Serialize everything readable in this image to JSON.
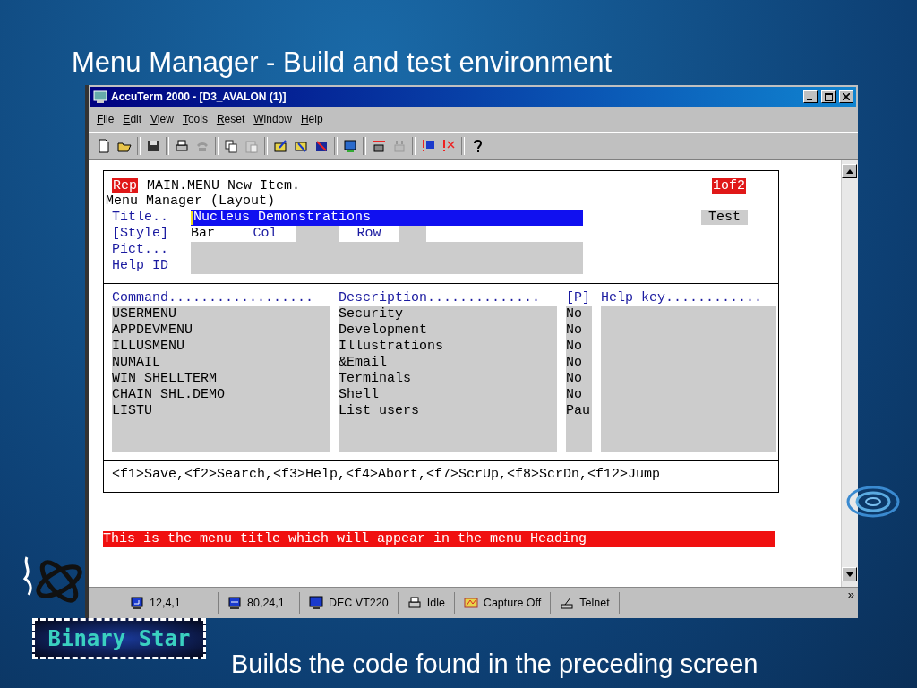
{
  "slide_title": "Menu Manager - Build and test environment",
  "window": {
    "title": "AccuTerm 2000 - [D3_AVALON (1)]"
  },
  "menu": [
    "File",
    "Edit",
    "View",
    "Tools",
    "Reset",
    "Window",
    "Help"
  ],
  "terminal": {
    "mode_badge": "Rep",
    "heading": "MAIN.MENU New Item.",
    "page_badge": "1of2",
    "section": "Menu Manager (Layout)",
    "fields": [
      {
        "label": "Title.."
      },
      {
        "label": "[Style]"
      },
      {
        "label": "Pict..."
      },
      {
        "label": "Help ID"
      }
    ],
    "title_value": "Nucleus Demonstrations",
    "style_options": [
      "Bar",
      "Col",
      "Row"
    ],
    "test_button": "Test",
    "columns": [
      "Command..................",
      "Description..............",
      "[P]",
      "Help key............"
    ],
    "rows": [
      {
        "command": "USERMENU",
        "description": "Security",
        "p": "No"
      },
      {
        "command": "APPDEVMENU",
        "description": "Development",
        "p": "No"
      },
      {
        "command": "ILLUSMENU",
        "description": "Illustrations",
        "p": "No"
      },
      {
        "command": "NUMAIL",
        "description": "&Email",
        "p": "No"
      },
      {
        "command": "WIN SHELLTERM",
        "description": "Terminals",
        "p": "No"
      },
      {
        "command": "CHAIN SHL.DEMO",
        "description": "Shell",
        "p": "No"
      },
      {
        "command": "LISTU",
        "description": "List users",
        "p": "Pau"
      }
    ],
    "function_keys": "<f1>Save,<f2>Search,<f3>Help,<f4>Abort,<f7>ScrUp,<f8>ScrDn,<f12>Jump",
    "message": "This is the menu title which will appear in the menu Heading"
  },
  "status_bar": [
    {
      "kind": "cursor",
      "text": "12,4,1"
    },
    {
      "kind": "size",
      "text": "80,24,1"
    },
    {
      "kind": "terminal",
      "text": "DEC VT220"
    },
    {
      "kind": "printer",
      "text": "Idle"
    },
    {
      "kind": "capture",
      "text": "Capture Off"
    },
    {
      "kind": "connection",
      "text": "Telnet"
    }
  ],
  "status_overflow": "»",
  "logo_text": "Binary Star",
  "caption": "Builds the code found in the preceding screen"
}
